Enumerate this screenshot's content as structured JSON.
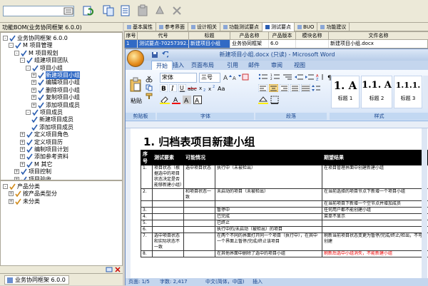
{
  "left_pane": {
    "title": "功能BOM(业务协同框架 6.0.0)",
    "tree": [
      {
        "label": "业务协同框架 6.0.0",
        "level": 0,
        "exp": "-"
      },
      {
        "label": "M 项目管理",
        "level": 1,
        "exp": "-"
      },
      {
        "label": "M 项目规划",
        "level": 2,
        "exp": "-"
      },
      {
        "label": "组建项目团队",
        "level": 3,
        "exp": "-"
      },
      {
        "label": "项目小组",
        "level": 4,
        "exp": "-"
      },
      {
        "label": "新建项目小组",
        "level": 5,
        "exp": "+",
        "selected": true
      },
      {
        "label": "编辑项目小组",
        "level": 5,
        "exp": "+"
      },
      {
        "label": "删除项目小组",
        "level": 5,
        "exp": "+"
      },
      {
        "label": "复制项目小组",
        "level": 5,
        "exp": "+"
      },
      {
        "label": "添加项目成员",
        "level": 5,
        "exp": "+"
      },
      {
        "label": "项目成员",
        "level": 4,
        "exp": "-"
      },
      {
        "label": "新建项目成员",
        "level": 5,
        "exp": ""
      },
      {
        "label": "添加项目成员",
        "level": 5,
        "exp": ""
      },
      {
        "label": "定义项目角色",
        "level": 3,
        "exp": "+"
      },
      {
        "label": "定义项目历",
        "level": 3,
        "exp": "+"
      },
      {
        "label": "编制项目计划",
        "level": 3,
        "exp": "+"
      },
      {
        "label": "添加参考资料",
        "level": 3,
        "exp": "+"
      },
      {
        "label": "M 其它",
        "level": 3,
        "exp": "+"
      },
      {
        "label": "项目控制",
        "level": 2,
        "exp": "+"
      },
      {
        "label": "项目验收",
        "level": 2,
        "exp": "+"
      }
    ],
    "tree2": [
      {
        "label": "产品分类",
        "level": 0,
        "exp": "-"
      },
      {
        "label": "按产品类型分",
        "level": 1,
        "exp": "+"
      },
      {
        "label": "未分类",
        "level": 1,
        "exp": "+"
      }
    ],
    "bottom_tab": "业务协同框架 6.0.0"
  },
  "tabs": [
    "基本属性",
    "参考界面",
    "设计相关",
    "功能测试要点",
    "测试要点",
    "BUO",
    "功能建议"
  ],
  "active_tab": 4,
  "grid": {
    "headers": [
      "序号",
      "代号",
      "标题",
      "产品名称",
      "产品版本",
      "模块名称",
      "文件名称"
    ],
    "row": [
      "1",
      "测试要点-70257392...",
      "新建项目小组",
      "业务协同框架",
      "6.0",
      "",
      "新建项目小组.docx"
    ]
  },
  "word": {
    "title": "新建项目小组.docx (只读) - Microsoft Word",
    "menu": [
      "开始",
      "插入",
      "页面布局",
      "引用",
      "邮件",
      "审阅",
      "视图"
    ],
    "font_name": "宋体",
    "font_size": "三号",
    "paste_label": "粘贴",
    "groups": [
      "剪贴板",
      "字体",
      "段落",
      "样式"
    ],
    "styles": [
      {
        "big": "1. A",
        "name": "标题 1"
      },
      {
        "big": "1.1. A",
        "name": "标题 2"
      },
      {
        "big": "1.1.1.",
        "name": "标题 3"
      }
    ],
    "doc_title": "1. 归档表项目新建小组",
    "table_headers": [
      "序号",
      "测试要素",
      "可能情况",
      "",
      "期望结果"
    ],
    "rows": [
      {
        "n": "1.",
        "a": "项目状态（根据选中的项目状态决定是否能够新建小组）",
        "b": "选中项目状态",
        "c": "执行中（未被检出）",
        "d": "在项目管理界面中创建新建小组"
      },
      {
        "n": "2.",
        "a": "",
        "b": "和项目状态一致",
        "c": "未启动的项目（未被检出）",
        "d": "在当前选择的项目节点下新增一个项目小组"
      },
      {
        "n": "",
        "a": "",
        "b": "",
        "c": "",
        "d": "在当前项目下新增一个空节点并增加成员"
      },
      {
        "n": "3.",
        "a": "",
        "b": "",
        "c": "暂停中",
        "d": "任何用户都不能创建小组"
      },
      {
        "n": "4.",
        "a": "",
        "b": "",
        "c": "已完成",
        "d": "菜单不显示"
      },
      {
        "n": "5.",
        "a": "",
        "b": "",
        "c": "已终止",
        "d": ""
      },
      {
        "n": "6.",
        "a": "",
        "b": "",
        "c": "执行中的/未启动（被检出）的项目",
        "d": ""
      },
      {
        "n": "7.",
        "a": "选中项目状态和实际状态不一致",
        "b": "",
        "c": "在两个不同的界面打开同一个项目（执行中），在其中一个界面上暂停/完成/终止该项目",
        "d": "刷新当前项目状态变更为暂停/完成/终止/检出，不可以创建"
      },
      {
        "n": "8.",
        "a": "",
        "b": "",
        "c": "在其他界面中删除了选中的项目小组",
        "d": "刷新后选中小组消失，不能新建小组"
      }
    ],
    "status": [
      "页面: 1/5",
      "字数: 2,417",
      "中文(简体，中国)",
      "插入"
    ]
  },
  "colors": {
    "selection": "#316ac5",
    "ribbon": "#d5e3f6",
    "highlight": "#ffee00"
  }
}
